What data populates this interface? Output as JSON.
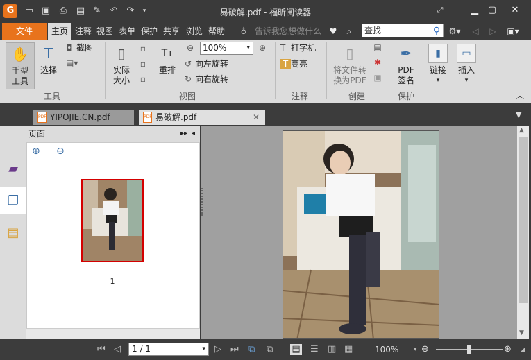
{
  "window": {
    "title": "易破解.pdf - 福昕阅读器"
  },
  "menu": {
    "file": "文件",
    "tabs": [
      "主页",
      "注释",
      "视图",
      "表单",
      "保护",
      "共享",
      "浏览",
      "帮助"
    ],
    "tell_me_placeholder": "告诉我您想做什么",
    "search_placeholder": "查找"
  },
  "ribbon": {
    "hand_tool": "手型\n工具",
    "select": "选择",
    "screenshot": "截图",
    "actual_size": "实际\n大小",
    "reflow": "重排",
    "zoom_value": "100%",
    "rotate_left": "向左旋转",
    "rotate_right": "向右旋转",
    "typewriter": "打字机",
    "highlight": "高亮",
    "convert_to_pdf": "将文件转\n换为PDF",
    "pdf_sign": "PDF\n签名",
    "link": "链接",
    "insert": "插入",
    "groups": {
      "tools": "工具",
      "view": "视图",
      "comment": "注释",
      "create": "创建",
      "protect": "保护"
    }
  },
  "doc_tabs": [
    {
      "label": "YIPOJIE.CN.pdf",
      "active": false
    },
    {
      "label": "易破解.pdf",
      "active": true
    }
  ],
  "panel": {
    "title": "页面",
    "thumbnail_page": "1"
  },
  "status": {
    "page_display": "1 / 1",
    "zoom": "100%"
  },
  "colors": {
    "accent": "#e8731c",
    "chrome": "#3a3a3a",
    "ribbon_bg": "#dcdcdc"
  }
}
